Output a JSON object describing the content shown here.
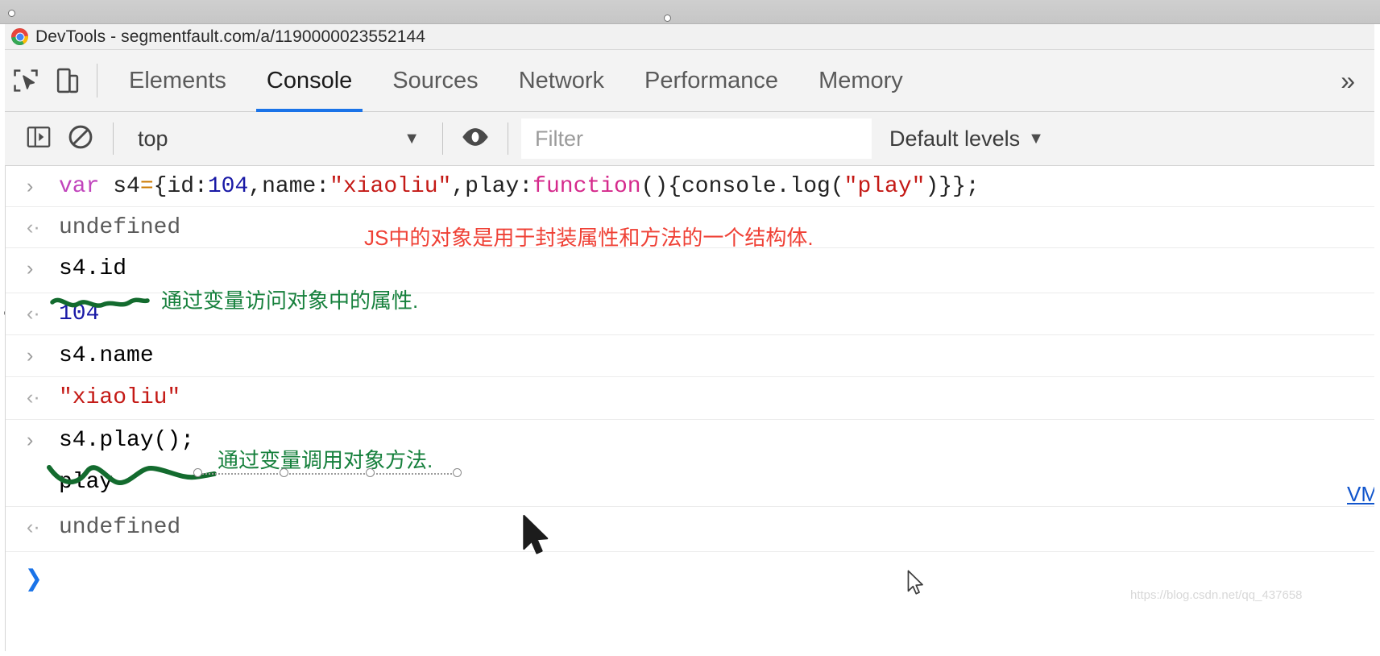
{
  "window": {
    "title": "DevTools - segmentfault.com/a/1190000023552144",
    "logo_icon": "chrome-logo"
  },
  "devtools": {
    "inspect_icon": "inspect-element-icon",
    "device_icon": "device-toolbar-icon",
    "tabs": [
      {
        "label": "Elements",
        "active": false
      },
      {
        "label": "Console",
        "active": true
      },
      {
        "label": "Sources",
        "active": false
      },
      {
        "label": "Network",
        "active": false
      },
      {
        "label": "Performance",
        "active": false
      },
      {
        "label": "Memory",
        "active": false
      }
    ],
    "more_tabs_label": "»",
    "active_tab_accent": "#1a73e8"
  },
  "console_toolbar": {
    "sidebar_icon": "console-sidebar-icon",
    "clear_icon": "clear-console-icon",
    "context": {
      "value": "top",
      "caret": "▼"
    },
    "eye_icon": "live-expression-eye-icon",
    "filter": {
      "value": "",
      "placeholder": "Filter"
    },
    "levels": {
      "label": "Default levels",
      "caret": "▼"
    }
  },
  "console_rows": [
    {
      "type": "input",
      "marker": "›",
      "tokens": [
        {
          "text": "var ",
          "cls": "t-kw"
        },
        {
          "text": "s4",
          "cls": "t-pl"
        },
        {
          "text": "=",
          "cls": "t-op"
        },
        {
          "text": "{id:",
          "cls": "t-pl"
        },
        {
          "text": "104",
          "cls": "t-num"
        },
        {
          "text": ",name:",
          "cls": "t-pl"
        },
        {
          "text": "\"xiaoliu\"",
          "cls": "t-str"
        },
        {
          "text": ",play:",
          "cls": "t-pl"
        },
        {
          "text": "function",
          "cls": "t-fn"
        },
        {
          "text": "(){console.log(",
          "cls": "t-pl"
        },
        {
          "text": "\"play\"",
          "cls": "t-str"
        },
        {
          "text": ")}};",
          "cls": "t-pl"
        }
      ]
    },
    {
      "type": "output",
      "marker": "‹·",
      "tokens": [
        {
          "text": "undefined",
          "cls": "out-undef"
        }
      ]
    },
    {
      "type": "input",
      "marker": "›",
      "tokens": [
        {
          "text": "s4.id",
          "cls": "t-pl"
        }
      ]
    },
    {
      "type": "output",
      "marker": "‹·",
      "tokens": [
        {
          "text": "104",
          "cls": "out-num"
        }
      ]
    },
    {
      "type": "input",
      "marker": "›",
      "tokens": [
        {
          "text": "s4.name",
          "cls": "t-pl"
        }
      ]
    },
    {
      "type": "output",
      "marker": "‹·",
      "tokens": [
        {
          "text": "\"xiaoliu\"",
          "cls": "out-str"
        }
      ]
    },
    {
      "type": "input",
      "marker": "›",
      "tokens": [
        {
          "text": "s4.play();",
          "cls": "t-pl"
        }
      ]
    },
    {
      "type": "log",
      "marker": "",
      "tokens": [
        {
          "text": "play",
          "cls": "t-pl"
        }
      ]
    },
    {
      "type": "output",
      "marker": "‹·",
      "tokens": [
        {
          "text": "undefined",
          "cls": "out-undef"
        }
      ]
    }
  ],
  "annotations": [
    {
      "text": "JS中的对象是用于封装属性和方法的一个结构体.",
      "color": "#ef4136"
    },
    {
      "text": "通过变量访问对象中的属性.",
      "color": "#16803c"
    },
    {
      "text": "通过变量调用对象方法.",
      "color": "#16803c"
    }
  ],
  "vm_link": {
    "label": "VM"
  },
  "watermark": {
    "text": "https://blog.csdn.net/qq_437658"
  },
  "prompt": {
    "caret": "❯"
  }
}
